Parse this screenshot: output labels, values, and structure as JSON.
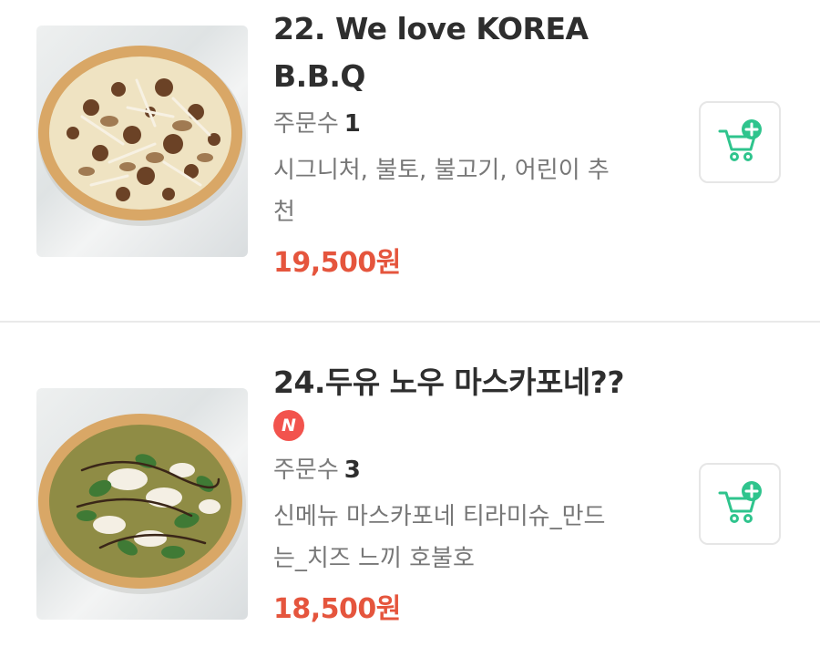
{
  "menu": {
    "items": [
      {
        "title_line1": "22. We love KOREA",
        "title_line2": "B.B.Q",
        "orders_label": "주문수",
        "orders_count": "1",
        "desc_line1": "시그니처, 불토, 불고기, 어린이 추",
        "desc_line2": "천",
        "price": "19,500원",
        "image_icon": "pizza-bbq-image",
        "cart_icon": "cart-add-icon"
      },
      {
        "title_line1": "24.두유 노우 마스카포네??",
        "badge": "N",
        "orders_label": "주문수",
        "orders_count": "3",
        "desc_line1": "신메뉴 마스카포네 티라미슈_만드",
        "desc_line2": "는_치즈 느끼 호불호",
        "price": "18,500원",
        "image_icon": "pizza-mascarpone-image",
        "cart_icon": "cart-add-icon"
      }
    ]
  },
  "colors": {
    "price": "#e5553d",
    "cart_accent": "#2fc48d",
    "new_badge": "#f2534d"
  }
}
